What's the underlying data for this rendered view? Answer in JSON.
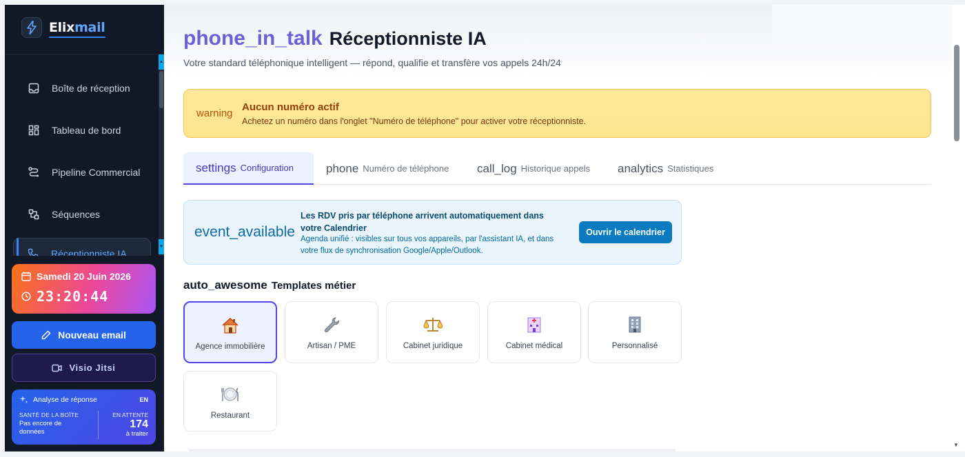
{
  "app": {
    "logo_text": "Elixmail",
    "logo_prefix": "Elix",
    "logo_suffix": "mail"
  },
  "sidebar": {
    "items": [
      {
        "label": "Boîte de réception",
        "icon": "inbox-icon"
      },
      {
        "label": "Tableau de bord",
        "icon": "dashboard-icon"
      },
      {
        "label": "Pipeline Commercial",
        "icon": "pipeline-icon"
      },
      {
        "label": "Séquences",
        "icon": "sequences-icon"
      },
      {
        "label": "Réceptionniste IA",
        "icon": "phone-icon",
        "active": true
      }
    ],
    "date_label": "Samedi 20 Juin 2026",
    "time_label": "23:20:44",
    "new_email_label": "Nouveau email",
    "visio_label": "Visio Jitsi",
    "analyse": {
      "title": "Analyse de réponse",
      "lang": "EN",
      "health_caption": "SANTÉ DE LA BOÎTE",
      "health_text": "Pas encore de données",
      "pending_caption": "EN ATTENTE",
      "pending_count": "174",
      "pending_suffix": "à traiter"
    }
  },
  "main": {
    "title_icon": "phone_in_talk",
    "title": "Réceptionniste IA",
    "subtitle": "Votre standard téléphonique intelligent — répond, qualifie et transfère vos appels 24h/24",
    "warning": {
      "icon": "warning",
      "title": "Aucun numéro actif",
      "text": "Achetez un numéro dans l'onglet \"Numéro de téléphone\" pour activer votre réceptionniste."
    },
    "tabs": [
      {
        "icon": "settings",
        "label": "Configuration",
        "active": true
      },
      {
        "icon": "phone",
        "label": "Numéro de téléphone"
      },
      {
        "icon": "call_log",
        "label": "Historique appels"
      },
      {
        "icon": "analytics",
        "label": "Statistiques"
      }
    ],
    "calendar": {
      "icon": "event_available",
      "title": "Les RDV pris par téléphone arrivent automatiquement dans votre Calendrier",
      "text": "Agenda unifié : visibles sur tous vos appareils, par l'assistant IA, et dans votre flux de synchronisation Google/Apple/Outlook.",
      "button": "Ouvrir le calendrier"
    },
    "templates": {
      "icon": "auto_awesome",
      "title": "Templates métier",
      "items": [
        {
          "name": "Agence immobilière",
          "icon": "house-icon",
          "active": true
        },
        {
          "name": "Artisan / PME",
          "icon": "wrench-icon"
        },
        {
          "name": "Cabinet juridique",
          "icon": "scales-icon"
        },
        {
          "name": "Cabinet médical",
          "icon": "hospital-icon"
        },
        {
          "name": "Personnalisé",
          "icon": "office-building-icon"
        },
        {
          "name": "Restaurant",
          "icon": "plate-icon"
        }
      ]
    }
  },
  "colors": {
    "accent": "#4f46e5",
    "sidebar_bg": "#111827",
    "warning_bg": "#fde68a",
    "calendar_button": "#0b7bc1",
    "primary_button": "#2563eb"
  }
}
